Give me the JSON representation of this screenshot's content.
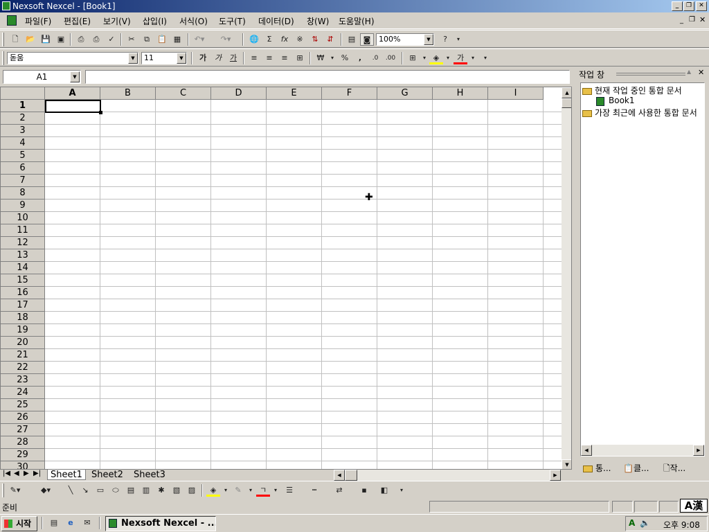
{
  "window": {
    "title": "Nexsoft Nexcel - [Book1]"
  },
  "menu": [
    "파일(F)",
    "편집(E)",
    "보기(V)",
    "삽입(I)",
    "서식(O)",
    "도구(T)",
    "데이터(D)",
    "창(W)",
    "도움말(H)"
  ],
  "toolbar1": {
    "zoom": "100%"
  },
  "toolbar2": {
    "font": "돋움",
    "size": "11",
    "bold": "가",
    "italic": "가",
    "underline": "가",
    "currency": "₩",
    "percent": "%",
    "comma": ",",
    "font_color_glyph": "가"
  },
  "formula": {
    "namebox": "A1",
    "content": ""
  },
  "columns": [
    "A",
    "B",
    "C",
    "D",
    "E",
    "F",
    "G",
    "H",
    "I"
  ],
  "rows": [
    "1",
    "2",
    "3",
    "4",
    "5",
    "6",
    "7",
    "8",
    "9",
    "10",
    "11",
    "12",
    "13",
    "14",
    "15",
    "16",
    "17",
    "18",
    "19",
    "20",
    "21",
    "22",
    "23",
    "24",
    "25",
    "26",
    "27",
    "28",
    "29",
    "30"
  ],
  "sheets": [
    "Sheet1",
    "Sheet2",
    "Sheet3"
  ],
  "taskpane": {
    "title": "작업 창",
    "current_header": "현재 작업 중인 통합 문서",
    "current_item": "Book1",
    "recent_header": "가장 최근에 사용한 통합 문서",
    "tabs": [
      "통...",
      "클...",
      "작..."
    ]
  },
  "status": {
    "text": "준비",
    "ime": "A漢"
  },
  "taskbar": {
    "start": "시작",
    "app": "Nexsoft Nexcel - ...",
    "clock": "오후 9:08"
  }
}
